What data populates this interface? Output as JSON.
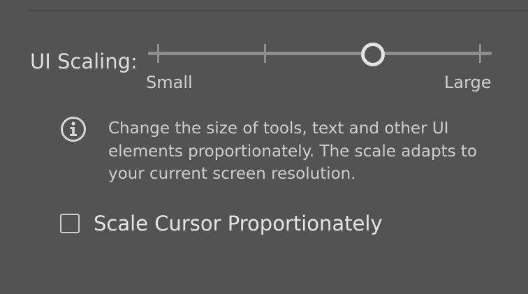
{
  "ui_scaling": {
    "label": "UI Scaling:",
    "min_label": "Small",
    "max_label": "Large",
    "steps": 5,
    "selected_step": 3,
    "icon": "info-icon",
    "description": "Change the size of tools, text and other UI elements proportionately. The scale adapts to your current screen resolution."
  },
  "scale_cursor": {
    "label": "Scale Cursor Proportionately",
    "checked": false
  },
  "colors": {
    "background": "#535353",
    "track": "#8e8e8e",
    "thumb": "#e3e3e3",
    "text": "#dcdcdc"
  }
}
